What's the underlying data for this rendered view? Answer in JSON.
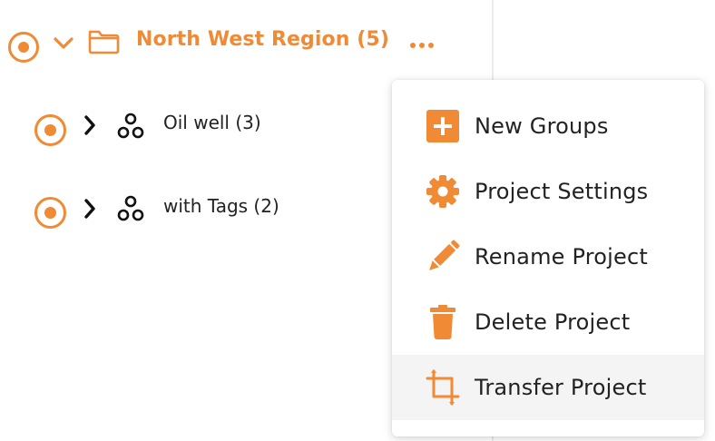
{
  "tree": {
    "region": {
      "label": "North West Region (5)"
    },
    "children": [
      {
        "label": "Oil well (3)"
      },
      {
        "label": "with Tags (2)"
      }
    ]
  },
  "context_menu": {
    "items": [
      {
        "label": "New Groups",
        "icon": "plus-square-icon"
      },
      {
        "label": "Project Settings",
        "icon": "gear-icon"
      },
      {
        "label": "Rename Project",
        "icon": "pencil-icon"
      },
      {
        "label": "Delete Project",
        "icon": "trash-icon"
      },
      {
        "label": "Transfer Project",
        "icon": "transfer-icon",
        "highlighted": true
      }
    ]
  },
  "colors": {
    "accent": "#f08a35",
    "text": "#222222",
    "hover": "#f4f4f4"
  }
}
